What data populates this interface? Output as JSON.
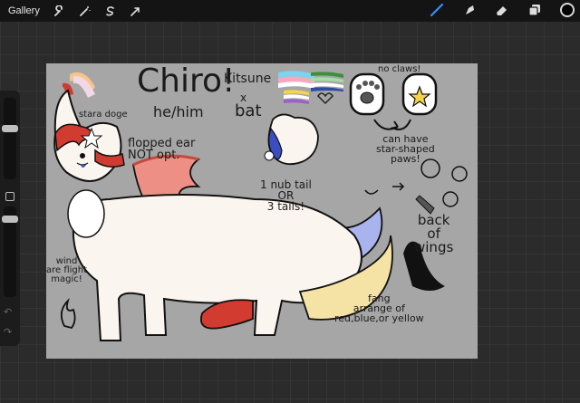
{
  "app": {
    "gallery_label": "Gallery",
    "left_tools": [
      {
        "name": "wrench-icon"
      },
      {
        "name": "magic-wand-icon"
      },
      {
        "name": "selection-icon"
      },
      {
        "name": "transform-arrow-icon"
      }
    ],
    "right_tools": [
      {
        "name": "brush-icon"
      },
      {
        "name": "smudge-icon"
      },
      {
        "name": "eraser-icon"
      },
      {
        "name": "layers-icon"
      }
    ],
    "current_color": "#000000"
  },
  "sidebar": {
    "brush_size_level": 0.2,
    "opacity_level": 0.55
  },
  "canvas": {
    "background": "#a6a6a6",
    "annotations": {
      "name": "Chiro!",
      "pronouns": "he/him",
      "species_kitsune": "Kitsune",
      "species_x": "x",
      "species_bat": "bat",
      "no_claws": "no claws!",
      "star_shaped": "can have\nstar-shaped\npaws!",
      "stara_doge": "stara doge",
      "flopped_ear": "flopped ear\nNOT opt.",
      "nub_tail": "1 nub tail\nOR\n3 tails!",
      "back_of_wings": "back\nof\nwings",
      "wind_magic": "wind\nare flight\nmagic!",
      "fang": "fang\narrange of\nred,blue,or yellow"
    },
    "colors": {
      "body": "#fbf5ef",
      "wing": "#ee8f86",
      "wing_dark": "#c24a3e",
      "hair": "#d23b2f",
      "tail_blue": "#a9b4ee",
      "tail_yellow": "#f5e3a6",
      "paw_star": "#f4d24a"
    }
  }
}
